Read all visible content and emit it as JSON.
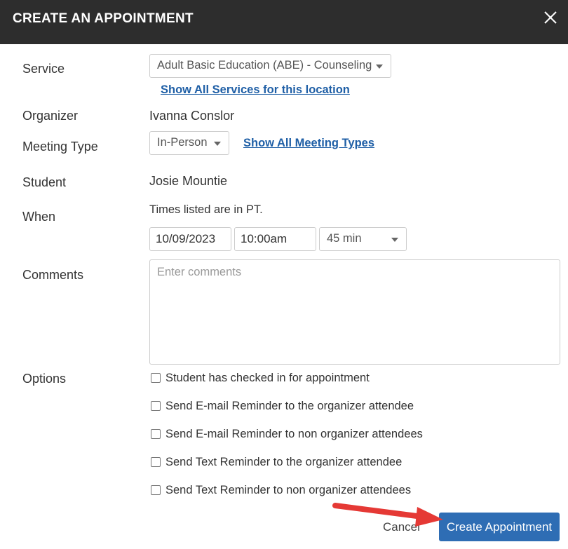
{
  "dialog": {
    "title": "CREATE AN APPOINTMENT",
    "close_icon": "close-icon"
  },
  "service": {
    "label": "Service",
    "selected": "Adult Basic Education (ABE) - Counseling",
    "show_all_link": "Show All Services for this location"
  },
  "organizer": {
    "label": "Organizer",
    "value": "Ivanna Conslor"
  },
  "meeting_type": {
    "label": "Meeting Type",
    "selected": "In-Person",
    "show_all_link": "Show All Meeting Types"
  },
  "student": {
    "label": "Student",
    "value": "Josie Mountie"
  },
  "when": {
    "label": "When",
    "note": "Times listed are in PT.",
    "date": "10/09/2023",
    "time": "10:00am",
    "duration": "45 min"
  },
  "comments": {
    "label": "Comments",
    "placeholder": "Enter comments",
    "value": ""
  },
  "options": {
    "label": "Options",
    "items": [
      {
        "label": "Student has checked in for appointment",
        "checked": false
      },
      {
        "label": "Send E-mail Reminder to the organizer attendee",
        "checked": false
      },
      {
        "label": "Send E-mail Reminder to non organizer attendees",
        "checked": false
      },
      {
        "label": "Send Text Reminder to the organizer attendee",
        "checked": false
      },
      {
        "label": "Send Text Reminder to non organizer attendees",
        "checked": false
      }
    ]
  },
  "footer": {
    "cancel_label": "Cancel",
    "create_label": "Create Appointment"
  },
  "colors": {
    "header_bg": "#2d2d2d",
    "primary_button": "#2e6db4",
    "link": "#1f5fa6",
    "annotation_arrow": "#e53935"
  }
}
